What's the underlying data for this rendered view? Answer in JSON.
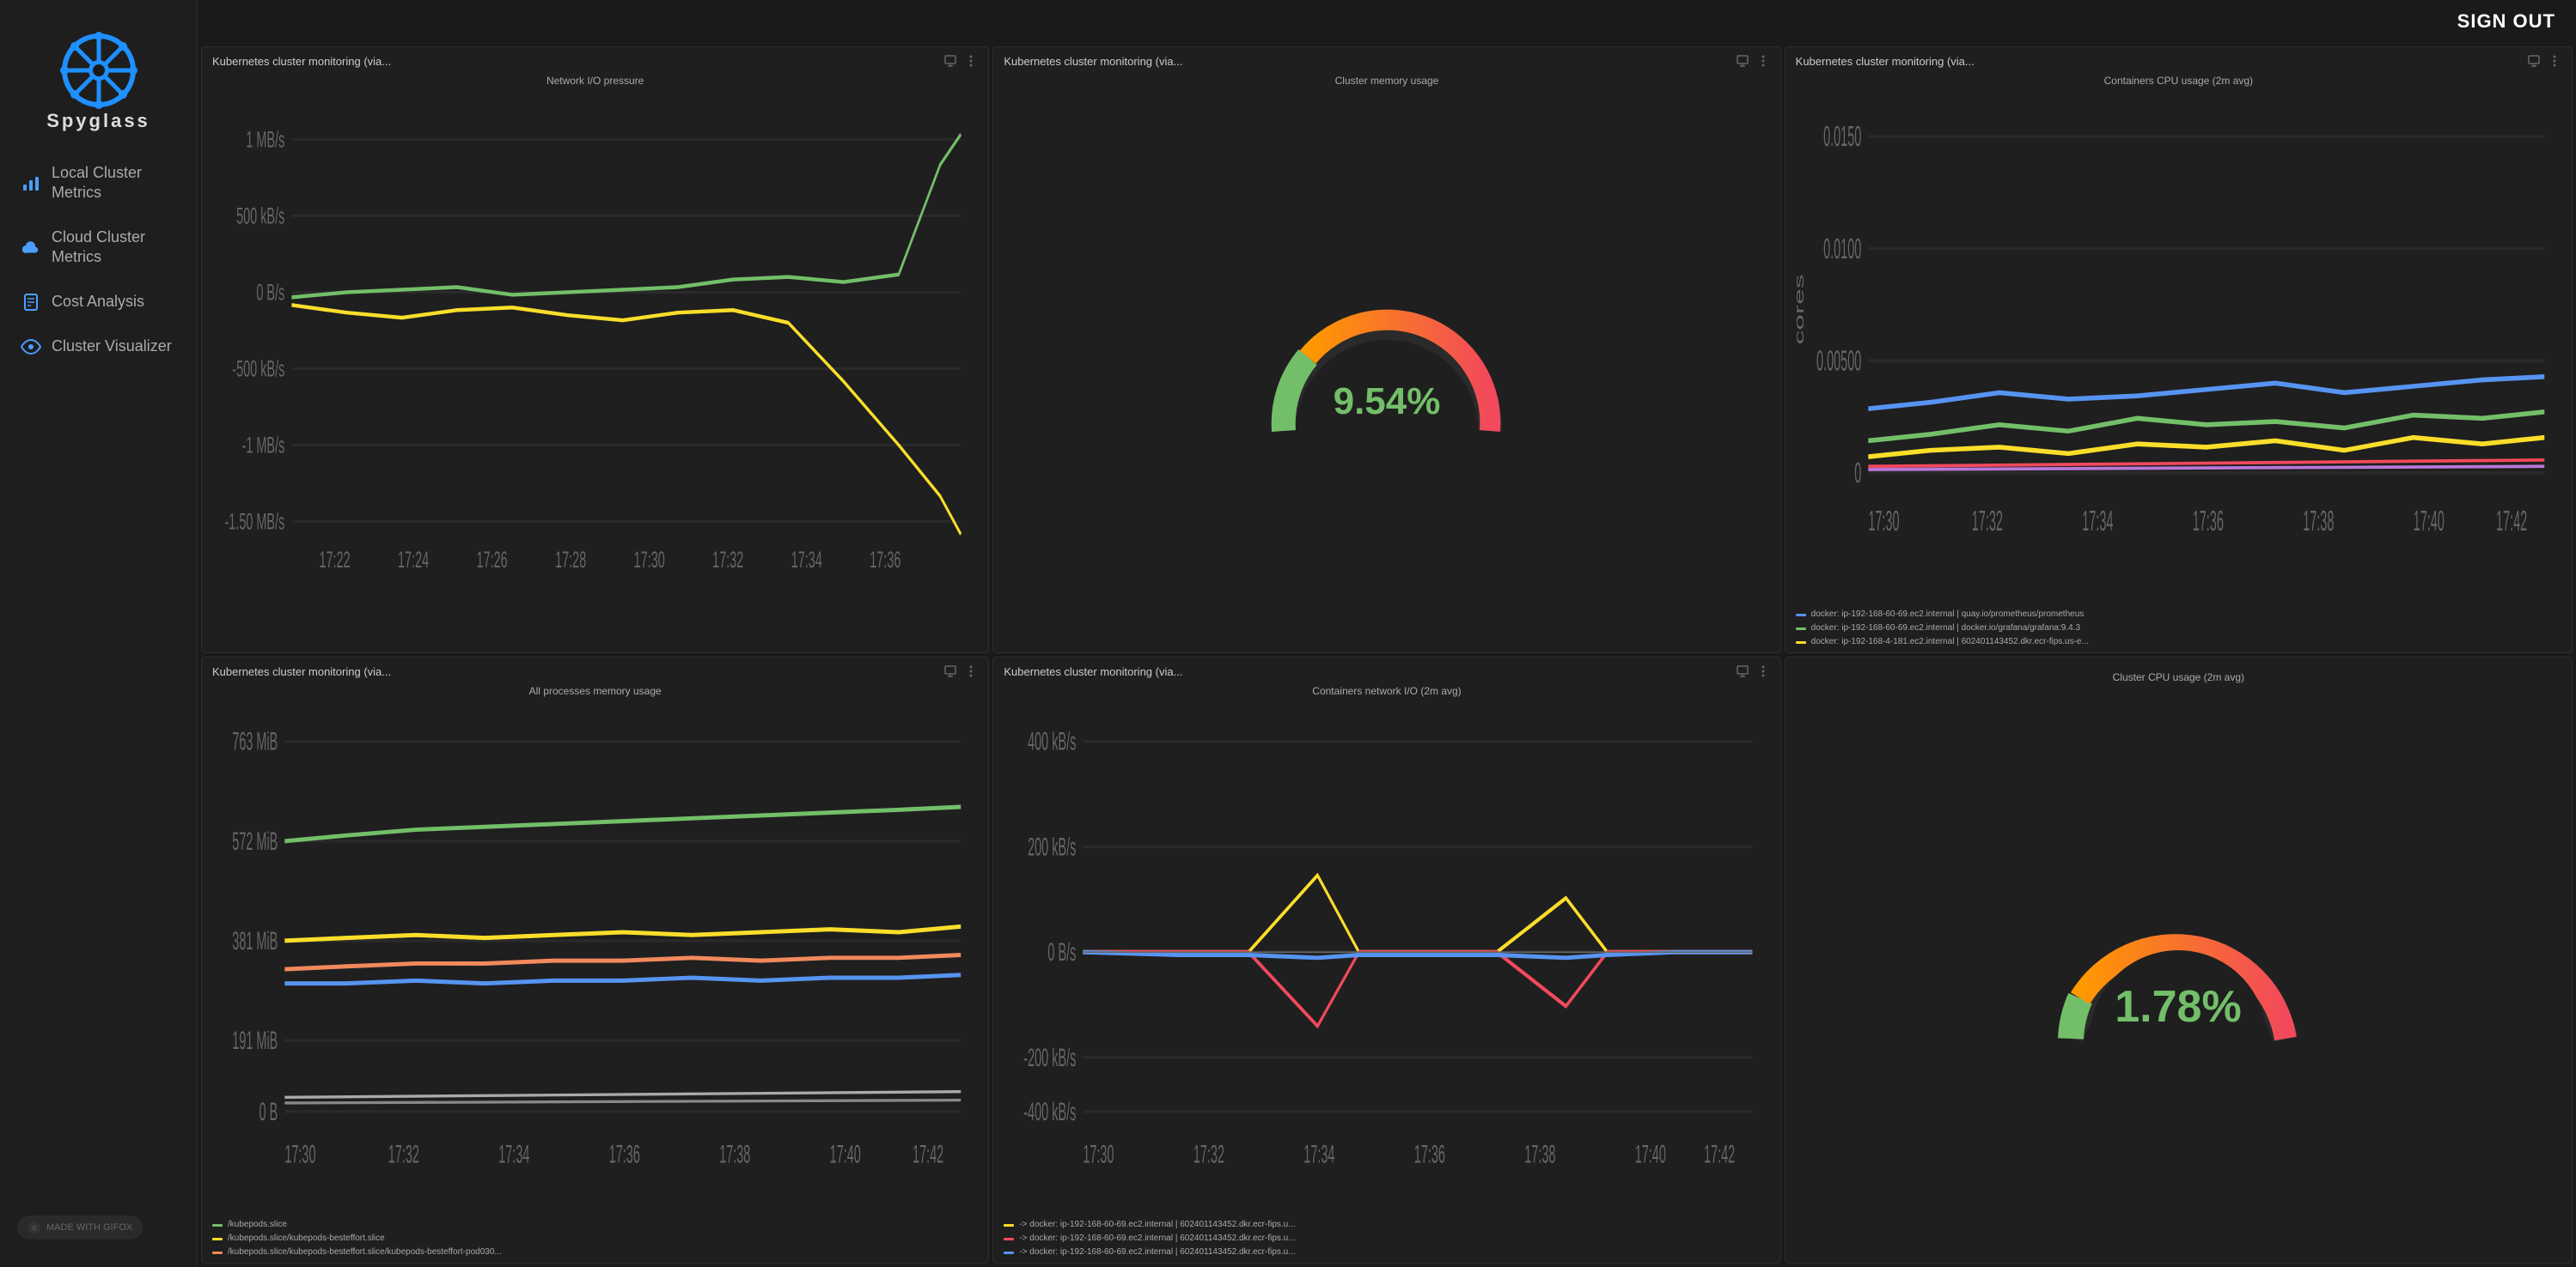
{
  "app": {
    "title": "Spyglass"
  },
  "topbar": {
    "sign_out_label": "SIGN OUT"
  },
  "sidebar": {
    "items": [
      {
        "id": "local-cluster-metrics",
        "label": "Local Cluster Metrics",
        "icon": "bar-chart-icon",
        "active": false
      },
      {
        "id": "cloud-cluster-metrics",
        "label": "Cloud Cluster Metrics",
        "icon": "cloud-icon",
        "active": false
      },
      {
        "id": "cost-analysis",
        "label": "Cost Analysis",
        "icon": "receipt-icon",
        "active": false
      },
      {
        "id": "cluster-visualizer",
        "label": "Cluster Visualizer",
        "icon": "eye-icon",
        "active": false
      }
    ],
    "footer": "MADE WITH GIFOX"
  },
  "panels": [
    {
      "id": "panel-1",
      "title": "Kubernetes cluster monitoring (via...",
      "chart_title": "Network I/O pressure",
      "type": "line",
      "y_labels": [
        "1 MB/s",
        "500 kB/s",
        "0 B/s",
        "-500 kB/s",
        "-1 MB/s",
        "-1.50 MB/s"
      ],
      "x_labels": [
        "17:22",
        "17:24",
        "17:26",
        "17:28",
        "17:30",
        "17:32",
        "17:34",
        "17:36"
      ],
      "legend": []
    },
    {
      "id": "panel-2",
      "title": "Kubernetes cluster monitoring (via...",
      "chart_title": "Cluster memory usage",
      "type": "gauge",
      "value": "9.54%",
      "gauge_pct": 9.54,
      "legend": []
    },
    {
      "id": "panel-3",
      "title": "Kubernetes cluster monitoring (via...",
      "chart_title": "Containers CPU usage (2m avg)",
      "type": "line_cpu",
      "y_labels": [
        "0.0150",
        "0.0100",
        "0.00500",
        "0"
      ],
      "x_labels": [
        "17:30",
        "17:32",
        "17:34",
        "17:36",
        "17:38",
        "17:40",
        "17:42"
      ],
      "y_axis_unit": "cores",
      "legend": [
        {
          "color": "#5794f2",
          "label": "docker: ip-192-168-60-69.ec2.internal | quay.io/prometheus/prometheus"
        },
        {
          "color": "#73bf69",
          "label": "docker: ip-192-168-60-69.ec2.internal | docker.io/grafana/grafana:9.4.3"
        },
        {
          "color": "#fade2a",
          "label": "docker: ip-192-168-4-181.ec2.internal | 602401143452.dkr.ecr-fips.us-e..."
        }
      ]
    },
    {
      "id": "panel-4",
      "title": "Kubernetes cluster monitoring (via...",
      "chart_title": "All processes memory usage",
      "type": "line_mem",
      "y_labels": [
        "763 MiB",
        "572 MiB",
        "381 MiB",
        "191 MiB",
        "0 B"
      ],
      "x_labels": [
        "17:30",
        "17:32",
        "17:34",
        "17:36",
        "17:38",
        "17:40",
        "17:42"
      ],
      "legend": [
        {
          "color": "#73bf69",
          "label": "/kubepods.slice"
        },
        {
          "color": "#fade2a",
          "label": "/kubepods.slice/kubepods-besteffort.slice"
        },
        {
          "color": "#f2895c",
          "label": "/kubepods.slice/kubepods-besteffort.slice/kubepods-besteffort-pod030..."
        }
      ]
    },
    {
      "id": "panel-5",
      "title": "Kubernetes cluster monitoring (via...",
      "chart_title": "Containers network I/O (2m avg)",
      "type": "line_net",
      "y_labels": [
        "400 kB/s",
        "200 kB/s",
        "0 B/s",
        "-200 kB/s",
        "-400 kB/s"
      ],
      "x_labels": [
        "17:30",
        "17:32",
        "17:34",
        "17:36",
        "17:38",
        "17:40",
        "17:42"
      ],
      "legend": [
        {
          "color": "#fade2a",
          "label": "-> docker: ip-192-168-60-69.ec2.internal | 602401143452.dkr.ecr-fips.u..."
        },
        {
          "color": "#f2495c",
          "label": "-> docker: ip-192-168-60-69.ec2.internal | 602401143452.dkr.ecr-fips.u..."
        },
        {
          "color": "#5794f2",
          "label": "-> docker: ip-192-168-60-69.ec2.internal | 602401143452.dkr.ecr-fips.u..."
        }
      ]
    },
    {
      "id": "panel-6",
      "title": "",
      "chart_title": "Cluster CPU usage (2m avg)",
      "type": "gauge2",
      "value": "1.78%",
      "gauge_pct": 1.78,
      "legend": []
    }
  ]
}
